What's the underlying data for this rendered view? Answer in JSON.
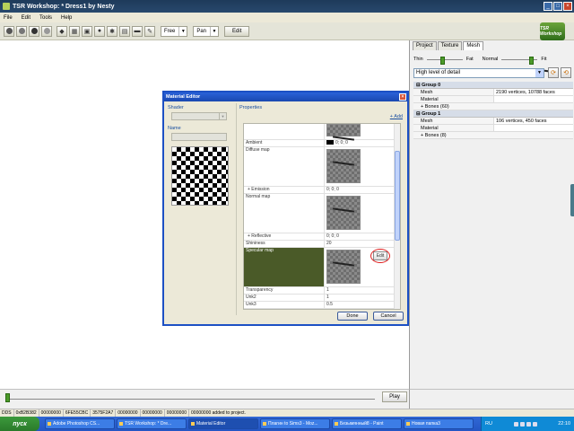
{
  "window": {
    "title": "TSR Workshop: * Dress1 by Nesty",
    "min": "_",
    "max": "□",
    "close": "×"
  },
  "menu": [
    "File",
    "Edit",
    "Tools",
    "Help"
  ],
  "toolbar": {
    "camera_mode": "Free",
    "pan_mode": "Pan",
    "edit_label": "Edit",
    "logo_text": "TSR Workshop"
  },
  "right_panel": {
    "tabs": [
      "Project",
      "Texture",
      "Mesh"
    ],
    "active_tab": "Mesh",
    "sliders": {
      "thin": "Thin",
      "fat": "Fat",
      "normal": "Normal",
      "fit": "Fit",
      "fat_level": 0.45,
      "fit_level": 0.88
    },
    "lod": "High level of detail",
    "groups": [
      {
        "name": "Group 0",
        "mesh_label": "Mesh",
        "mesh_value": "2190 vertices, 10788 faces",
        "material_label": "Material",
        "bones_label": "Bones (60)"
      },
      {
        "name": "Group 1",
        "mesh_label": "Mesh",
        "mesh_value": "106 vertices, 450 faces",
        "material_label": "Material",
        "bones_label": "Bones (8)"
      }
    ]
  },
  "material_editor": {
    "title": "Material Editor",
    "close": "×",
    "shader_label": "Shader",
    "name_label": "Name",
    "properties_label": "Properties",
    "add_link": "+ Add",
    "ambient_label": "Ambient",
    "ambient_value": "0; 0; 0",
    "diffuse_label": "Diffuse map",
    "emission_label": "+ Emission",
    "emission_value": "0; 0; 0",
    "normal_label": "Normal map",
    "reflective_label": "+ Reflective",
    "reflective_value": "0; 0; 0",
    "shininess_label": "Shininess",
    "shininess_value": "20",
    "specular_label": "Specular map",
    "edit_label": "Edit",
    "transparency_label": "Transparency",
    "transparency_value": "1",
    "unk2_label": "Unk2",
    "unk2_value": "1",
    "unk3_label": "Unk3",
    "unk3_value": "0.5",
    "done_label": "Done",
    "cancel_label": "Cancel"
  },
  "timeline": {
    "play_label": "Play",
    "position": 0.0
  },
  "statusbar": [
    "DDS",
    "0xB2B382",
    "00000000",
    "6FE55CBC",
    "3575F2A7",
    "00000000",
    "00000000",
    "00000000",
    "00000000 added to project."
  ],
  "taskbar": {
    "start_label": "пуск",
    "tasks": [
      "Adobe Photoshop CS...",
      "TSR Workshop: * Dre...",
      "Material Editor",
      "Плагин to Sims3 - Moz...",
      "Безымянный8 - Paint",
      "Новая папка3"
    ],
    "active_task": 2,
    "lang": "RU",
    "clock": "22:10"
  }
}
